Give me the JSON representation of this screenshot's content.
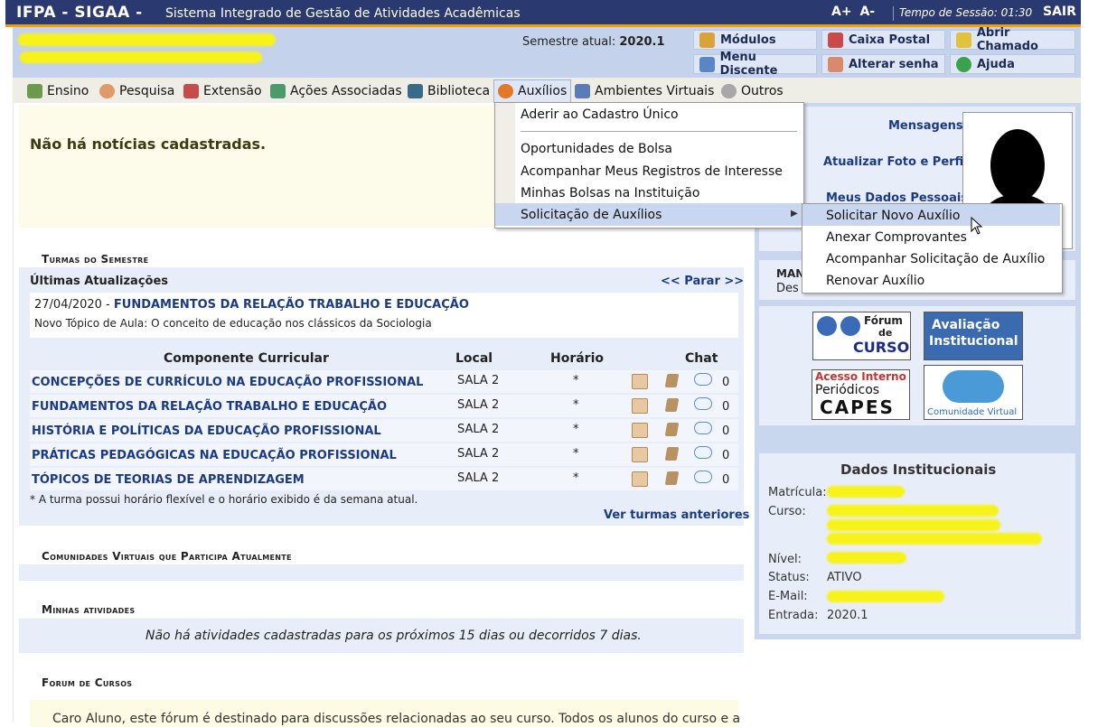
{
  "topbar": {
    "brand": "IFPA - SIGAA -",
    "system_name": "Sistema Integrado de Gestão de Atividades Acadêmicas",
    "font_increase": "A+",
    "font_decrease": "A-",
    "session": "Tempo de Sessão: 01:30",
    "logout": "SAIR"
  },
  "header": {
    "semester_label": "Semestre atual:",
    "semester_value": "2020.1",
    "buttons": {
      "modulos": "Módulos",
      "caixa_postal": "Caixa Postal",
      "abrir_chamado": "Abrir Chamado",
      "menu_discente": "Menu Discente",
      "alterar_senha": "Alterar senha",
      "ajuda": "Ajuda"
    }
  },
  "menu": {
    "ensino": "Ensino",
    "pesquisa": "Pesquisa",
    "extensao": "Extensão",
    "acoes": "Ações Associadas",
    "biblioteca": "Biblioteca",
    "auxilios": "Auxílios",
    "ambientes": "Ambientes Virtuais",
    "outros": "Outros"
  },
  "dropdown": {
    "items": [
      "Aderir ao Cadastro Único",
      "Oportunidades de Bolsa",
      "Acompanhar Meus Registros de Interesse",
      "Minhas Bolsas na Instituição",
      "Solicitação de Auxílios"
    ],
    "submenu": [
      "Solicitar Novo Auxílio",
      "Anexar Comprovantes",
      "Acompanhar Solicitação de Auxílio",
      "Renovar Auxílio"
    ]
  },
  "news": {
    "empty": "Não há notícias cadastradas."
  },
  "turmas": {
    "title": "Turmas do Semestre",
    "updates_title": "Últimas Atualizações",
    "stop": "<< Parar >>",
    "update_date": "27/04/2020 - ",
    "update_course": "FUNDAMENTOS DA RELAÇÃO TRABALHO E EDUCAÇÃO",
    "update_text": "Novo Tópico de Aula: O conceito de educação nos clássicos da Sociologia",
    "headers": {
      "componente": "Componente Curricular",
      "local": "Local",
      "horario": "Horário",
      "chat": "Chat"
    },
    "rows": [
      {
        "name": "CONCEPÇÕES DE CURRÍCULO NA EDUCAÇÃO PROFISSIONAL",
        "local": "SALA 2",
        "horario": "*",
        "chat": "0"
      },
      {
        "name": "FUNDAMENTOS DA RELAÇÃO TRABALHO E EDUCAÇÃO",
        "local": "SALA 2",
        "horario": "*",
        "chat": "0"
      },
      {
        "name": "HISTÓRIA E POLÍTICAS DA EDUCAÇÃO PROFISSIONAL",
        "local": "SALA 2",
        "horario": "*",
        "chat": "0"
      },
      {
        "name": "PRÁTICAS PEDAGÓGICAS NA EDUCAÇÃO PROFISSIONAL",
        "local": "SALA 2",
        "horario": "*",
        "chat": "0"
      },
      {
        "name": "TÓPICOS DE TEORIAS DE APRENDIZAGEM",
        "local": "SALA 2",
        "horario": "*",
        "chat": "0"
      }
    ],
    "footnote": "* A turma possui horário flexível e o horário exibido é da semana atual.",
    "previous": "Ver turmas anteriores"
  },
  "comunidades": {
    "title": "Comunidades Virtuais que Participa Atualmente"
  },
  "atividades": {
    "title": "Minhas atividades",
    "empty": "Não há atividades cadastradas para os próximos 15 dias ou decorridos 7 dias."
  },
  "forum": {
    "title": "Forum de Cursos",
    "text": "Caro Aluno, este fórum é destinado para discussões relacionadas ao seu curso. Todos os alunos do curso e a"
  },
  "profile": {
    "mensagens": "Mensagens",
    "atualizar": "Atualizar Foto e Perfil",
    "dados": "Meus Dados Pessoais",
    "mand_title": "MAN",
    "mand_text": "Des"
  },
  "logos": {
    "forum_curso": [
      "Fórum",
      "de",
      "CURSO"
    ],
    "avaliacao": [
      "Avaliação",
      "Institucional"
    ],
    "periodicos": [
      "Acesso Interno",
      "Periódicos",
      "CAPES"
    ],
    "comunidade": "Comunidade Virtual"
  },
  "dados": {
    "title": "Dados Institucionais",
    "labels": {
      "matricula": "Matrícula:",
      "curso": "Curso:",
      "nivel": "Nível:",
      "status": "Status:",
      "email": "E-Mail:",
      "entrada": "Entrada:"
    },
    "status": "ATIVO",
    "entrada": "2020.1"
  },
  "colors": {
    "topbar": "#2a3a70",
    "accent": "#f0a000",
    "link": "#1a3a88",
    "panel": "#e8eef9"
  }
}
